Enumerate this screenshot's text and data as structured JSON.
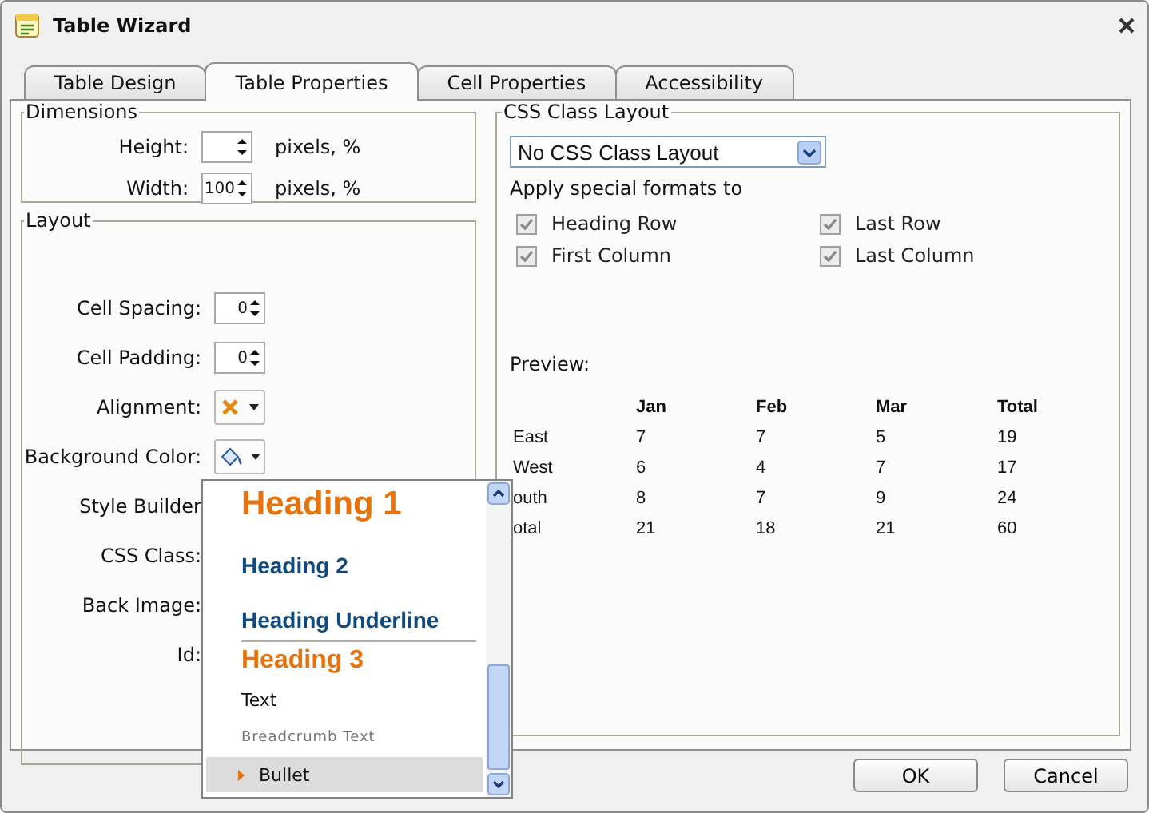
{
  "window": {
    "title": "Table Wizard"
  },
  "tabs": [
    {
      "label": "Table Design",
      "selected": false
    },
    {
      "label": "Table Properties",
      "selected": true
    },
    {
      "label": "Cell Properties",
      "selected": false
    },
    {
      "label": "Accessibility",
      "selected": false
    }
  ],
  "dimensions": {
    "legend": "Dimensions",
    "fields": [
      {
        "label": "Height:",
        "unit": "pixels, %"
      },
      {
        "label": "Width:",
        "value": "100",
        "unit": "pixels, %"
      }
    ]
  },
  "layout": {
    "legend": "Layout",
    "rows": [
      {
        "label": "Cell Spacing:",
        "kind": "spin",
        "value": "0"
      },
      {
        "label": "Cell Padding:",
        "kind": "spin",
        "value": "0"
      },
      {
        "label": "Alignment:",
        "kind": "align"
      },
      {
        "label": "Background Color:",
        "kind": "color"
      },
      {
        "label": "Style Builder",
        "kind": "hidden"
      },
      {
        "label": "CSS Class:",
        "kind": "hidden"
      },
      {
        "label": "Back Image:",
        "kind": "hidden"
      },
      {
        "label": "Id:",
        "kind": "hidden"
      }
    ]
  },
  "css_layout": {
    "legend": "CSS Class Layout",
    "select": "No CSS Class Layout",
    "apply_label": "Apply special formats to",
    "checkboxes": [
      {
        "label": "Heading Row",
        "checked": true,
        "disabled": true
      },
      {
        "label": "Last Row",
        "checked": true,
        "disabled": true
      },
      {
        "label": "First Column",
        "checked": true,
        "disabled": true
      },
      {
        "label": "Last Column",
        "checked": true,
        "disabled": true
      }
    ]
  },
  "preview": {
    "label": "Preview:",
    "columns": [
      "",
      "Jan",
      "Feb",
      "Mar",
      "Total"
    ],
    "rows": [
      [
        "East",
        "7",
        "7",
        "5",
        "19"
      ],
      [
        "West",
        "6",
        "4",
        "7",
        "17"
      ],
      [
        "outh",
        "8",
        "7",
        "9",
        "24"
      ],
      [
        "otal",
        "21",
        "18",
        "21",
        "60"
      ]
    ]
  },
  "style_menu": {
    "items": [
      {
        "kind": "heading1",
        "label": "Heading 1",
        "selected": false
      },
      {
        "kind": "heading2",
        "label": "Heading 2",
        "selected": false
      },
      {
        "kind": "underline",
        "label": "Heading Underline",
        "selected": false
      },
      {
        "kind": "heading3",
        "label": "Heading 3",
        "selected": false
      },
      {
        "kind": "text",
        "label": "Text",
        "selected": false
      },
      {
        "kind": "breadcrumb",
        "label": "Breadcrumb Text",
        "selected": false
      },
      {
        "kind": "bullet",
        "label": "Bullet",
        "selected": true
      }
    ]
  },
  "buttons": [
    "OK",
    "Cancel"
  ]
}
